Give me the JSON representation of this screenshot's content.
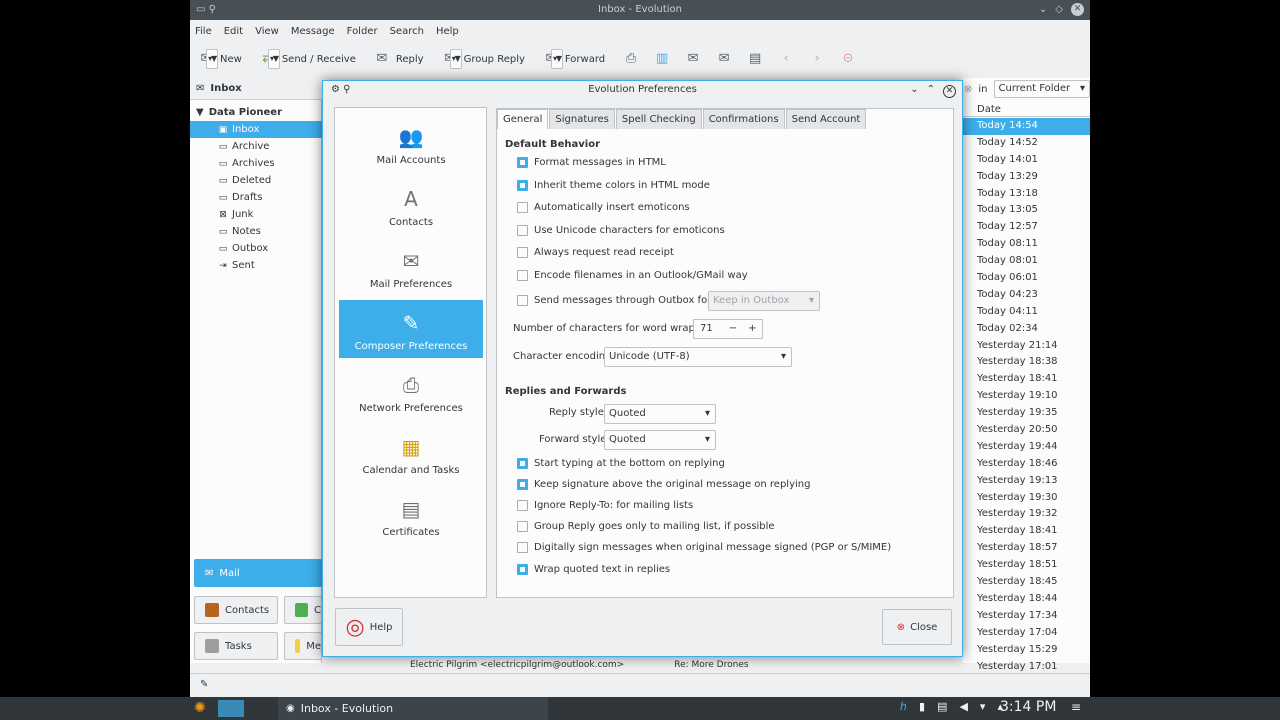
{
  "main_window": {
    "title": "Inbox - Evolution",
    "menu": [
      "File",
      "Edit",
      "View",
      "Message",
      "Folder",
      "Search",
      "Help"
    ],
    "toolbar": {
      "new": "New",
      "send_receive": "Send / Receive",
      "reply": "Reply",
      "group_reply": "Group Reply",
      "forward": "Forward"
    },
    "sidebar_header": "Inbox",
    "account": "Data Pioneer",
    "folders": [
      "Inbox",
      "Archive",
      "Archives",
      "Deleted",
      "Drafts",
      "Junk",
      "Notes",
      "Outbox",
      "Sent"
    ],
    "switcher": {
      "mail": "Mail",
      "contacts": "Contacts",
      "tasks": "Tasks",
      "memos_trunc": "Me"
    },
    "search_in_label": "in",
    "search_scope": "Current Folder",
    "date_header": "Date",
    "dates": [
      "Today 14:54",
      "Today 14:52",
      "Today 14:01",
      "Today 13:29",
      "Today 13:18",
      "Today 13:05",
      "Today 12:57",
      "Today 08:11",
      "Today 08:01",
      "Today 06:01",
      "Today 04:23",
      "Today 04:11",
      "Today 02:34",
      "Yesterday 21:14",
      "Yesterday 18:38",
      "Yesterday 18:41",
      "Yesterday 19:10",
      "Yesterday 19:35",
      "Yesterday 20:50",
      "Yesterday 19:44",
      "Yesterday 18:46",
      "Yesterday 19:13",
      "Yesterday 19:30",
      "Yesterday 19:32",
      "Yesterday 18:41",
      "Yesterday 18:57",
      "Yesterday 18:51",
      "Yesterday 18:45",
      "Yesterday 18:44",
      "Yesterday 17:34",
      "Yesterday 17:04",
      "Yesterday 15:29",
      "Yesterday 17:01"
    ],
    "status_from": "Electric Pilgrim <electricpilgrim@outlook.com>",
    "status_subject": "Re: More Drones"
  },
  "dialog": {
    "title": "Evolution Preferences",
    "categories": [
      "Mail Accounts",
      "Contacts",
      "Mail Preferences",
      "Composer Preferences",
      "Network Preferences",
      "Calendar and Tasks",
      "Certificates"
    ],
    "tabs": [
      "General",
      "Signatures",
      "Spell Checking",
      "Confirmations",
      "Send Account"
    ],
    "default_behavior": "Default Behavior",
    "opt": {
      "html": "Format messages in HTML",
      "theme": "Inherit theme colors in HTML mode",
      "emoticons": "Automatically insert emoticons",
      "unicode": "Use Unicode characters for emoticons",
      "receipt": "Always request read receipt",
      "encode": "Encode filenames in an Outlook/GMail way",
      "outbox": "Send messages through Outbox folder",
      "outbox_dd": "Keep in Outbox"
    },
    "wrap_label": "Number of characters for word wrapping:",
    "wrap_value": "71",
    "encoding_label": "Character encoding:",
    "encoding_value": "Unicode (UTF-8)",
    "replies_header": "Replies and Forwards",
    "reply_style_label": "Reply style:",
    "reply_style": "Quoted",
    "forward_style_label": "Forward style:",
    "forward_style": "Quoted",
    "opt2": {
      "bottom": "Start typing at the bottom on replying",
      "sig": "Keep signature above the original message on replying",
      "ignore": "Ignore Reply-To: for mailing lists",
      "group": "Group Reply goes only to mailing list, if possible",
      "sign": "Digitally sign messages when original message signed (PGP or S/MIME)",
      "wrapq": "Wrap quoted text in replies"
    },
    "help": "Help",
    "close": "Close"
  },
  "taskbar": {
    "task": "Inbox - Evolution",
    "clock": "3:14 PM"
  }
}
